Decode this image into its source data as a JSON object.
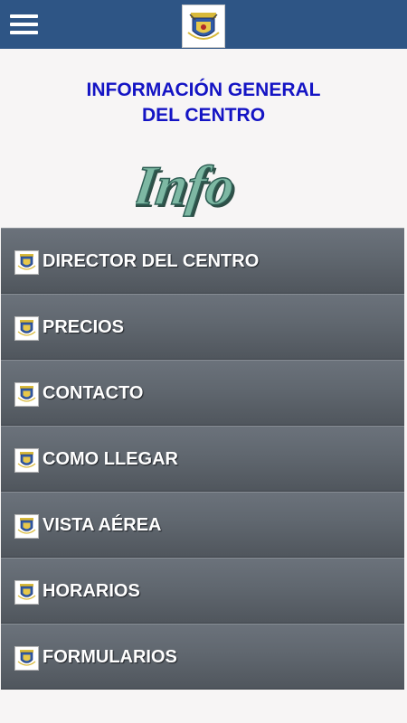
{
  "header": {
    "menu_icon": "hamburger-menu-icon",
    "logo_icon": "school-crest-icon"
  },
  "page": {
    "title_line1": "INFORMACIÓN GENERAL",
    "title_line2": "DEL CENTRO",
    "info_logo_text": "Info"
  },
  "menu": {
    "items": [
      {
        "label": "DIRECTOR DEL CENTRO"
      },
      {
        "label": "PRECIOS"
      },
      {
        "label": "CONTACTO"
      },
      {
        "label": "COMO LLEGAR"
      },
      {
        "label": "VISTA AÉREA"
      },
      {
        "label": "HORARIOS"
      },
      {
        "label": "FORMULARIOS"
      }
    ]
  },
  "colors": {
    "header_bg": "#2e5585",
    "title": "#1414c4",
    "menu_bg": "#60676f",
    "menu_text": "#ffffff"
  }
}
